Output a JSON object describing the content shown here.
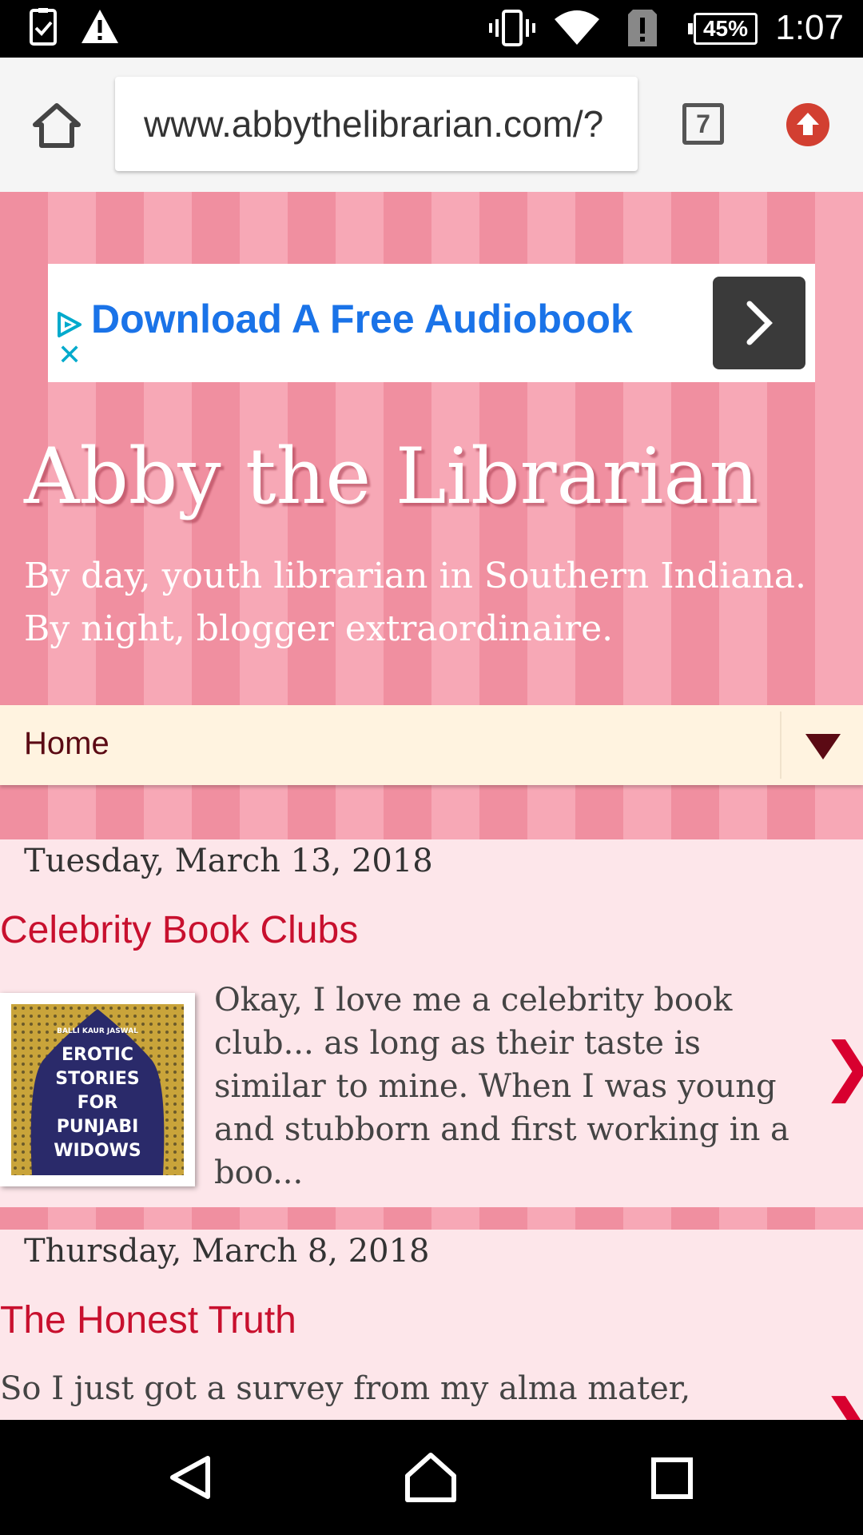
{
  "status_bar": {
    "battery": "45%",
    "time": "1:07",
    "icons": [
      "task-check-icon",
      "warning-icon",
      "vibrate-icon",
      "wifi-icon",
      "signal-alert-icon",
      "battery-icon"
    ]
  },
  "browser": {
    "url": "www.abbythelibrarian.com/?",
    "tab_count": "7",
    "icons": [
      "home-icon",
      "tabs-icon",
      "update-icon"
    ]
  },
  "ad": {
    "title": "Download A Free Audiobook",
    "icons": [
      "adchoices-icon",
      "close-icon",
      "chevron-right-icon"
    ]
  },
  "blog": {
    "title": "Abby the Librarian",
    "description": "By day, youth librarian in Southern Indiana. By night, blogger extraordinaire."
  },
  "nav": {
    "home_label": "Home"
  },
  "posts": [
    {
      "date": "Tuesday, March 13, 2018",
      "title": "Celebrity Book Clubs",
      "excerpt": "Okay, I love me a celebrity book club... as long as their taste is similar to mine. When I was young and stubborn and first working in a boo...",
      "thumbnail": {
        "author": "BALLI KAUR JASWAL",
        "lines": [
          "EROTIC",
          "STORIES",
          "FOR",
          "PUNJABI",
          "WIDOWS"
        ]
      }
    },
    {
      "date": "Thursday, March 8, 2018",
      "title": "The Honest Truth",
      "excerpt": "So I just got a survey from my alma mater,"
    }
  ],
  "system_nav": {
    "icons": [
      "back-icon",
      "home-icon",
      "recents-icon"
    ]
  },
  "colors": {
    "header_pink": "#f08fa0",
    "post_bg": "#fde6ea",
    "link_red": "#c8102e",
    "nav_bg": "#fff3e0",
    "ad_blue": "#1a73e8"
  }
}
